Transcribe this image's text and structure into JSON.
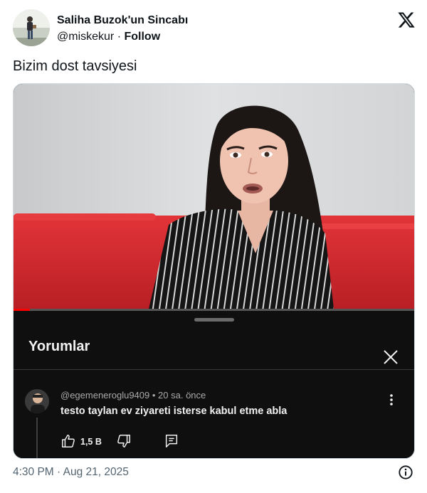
{
  "tweet": {
    "author_name": "Saliha Buzok'un Sincabı",
    "handle": "@miskekur",
    "separator": "·",
    "follow_label": "Follow",
    "text": "Bizim dost tavsiyesi",
    "timestamp": "4:30 PM · Aug 21, 2025",
    "brand_icon": "x-logo-icon",
    "info_icon": "info-icon"
  },
  "embedded_video": {
    "progress_fraction": 0.04,
    "comments_sheet": {
      "title": "Yorumlar",
      "close_icon": "close-icon",
      "comment": {
        "username": "@egemeneroglu9409",
        "dot": "•",
        "time_ago": "20 sa. önce",
        "text": "testo taylan ev ziyareti isterse kabul etme abla",
        "like_count": "1,5 B",
        "icons": [
          "thumbs-up-icon",
          "thumbs-down-icon",
          "reply-icon",
          "more-vertical-icon"
        ]
      }
    }
  },
  "colors": {
    "text_primary": "#0f1419",
    "text_secondary": "#536471",
    "sheet_background": "#0f0f0f",
    "sheet_text": "#f1f1f1",
    "sheet_meta": "#aaaaaa",
    "progress_red": "#ff0000",
    "sofa_red": "#d42a2e"
  }
}
